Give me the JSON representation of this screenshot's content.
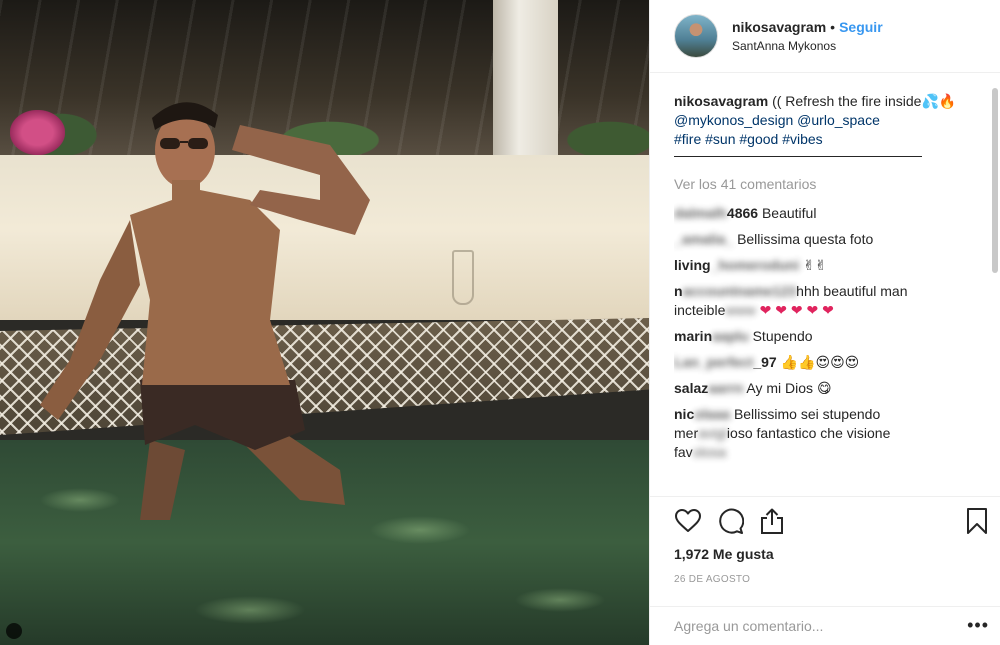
{
  "header": {
    "username": "nikosavagram",
    "separator": "•",
    "follow_label": "Seguir",
    "location": "SantAnna Mykonos"
  },
  "caption": {
    "username": "nikosavagram",
    "text": "(( Refresh the fire inside💦🔥",
    "mentions": [
      "@mykonos_design",
      "@urlo_space"
    ],
    "hashtags": [
      "#fire",
      "#sun",
      "#good",
      "#vibes"
    ]
  },
  "view_all_label": "Ver los 41 comentarios",
  "comments": [
    {
      "user_hidden": "dalmalh",
      "user_visible": "4866",
      "text": "Beautiful"
    },
    {
      "user_hidden": "_amalia_",
      "user_visible": "",
      "text": "Bellissima questa foto"
    },
    {
      "user_visible": "living",
      "user_hidden": "_homeroduni",
      "text": "✌✌"
    },
    {
      "user_visible": "n",
      "user_hidden": "accountname123",
      "text": "hhh beautiful man incteible",
      "text_hidden": "www",
      "hearts": "❤ ❤ ❤ ❤ ❤"
    },
    {
      "user_visible": "marin",
      "user_hidden": "aaplu",
      "text": "Stupendo"
    },
    {
      "user_hidden": "Lan_perfect",
      "user_visible": "_97",
      "text": "👍👍😍😍😍"
    },
    {
      "user_visible": "salaz",
      "user_hidden": "aarrn",
      "text": "Ay mi Dios 😋"
    },
    {
      "user_visible": "nic",
      "user_hidden": "olaaa",
      "text": "Bellissimo sei stupendo",
      "text2_visible_a": "mer",
      "text2_hidden": "avigl",
      "text2_visible_b": "ioso fantastico che visione",
      "text3_visible": "fav",
      "text3_hidden": "olosa"
    }
  ],
  "actions": {
    "likes": "1,972 Me gusta",
    "date": "26 DE AGOSTO",
    "icons": [
      "heart-icon",
      "comment-icon",
      "share-icon",
      "bookmark-icon"
    ]
  },
  "add_comment": {
    "placeholder": "Agrega un comentario...",
    "more_label": "•••"
  },
  "colors": {
    "link": "#3897f0",
    "mention": "#003569",
    "muted": "#999999",
    "heart": "#e0245e"
  }
}
